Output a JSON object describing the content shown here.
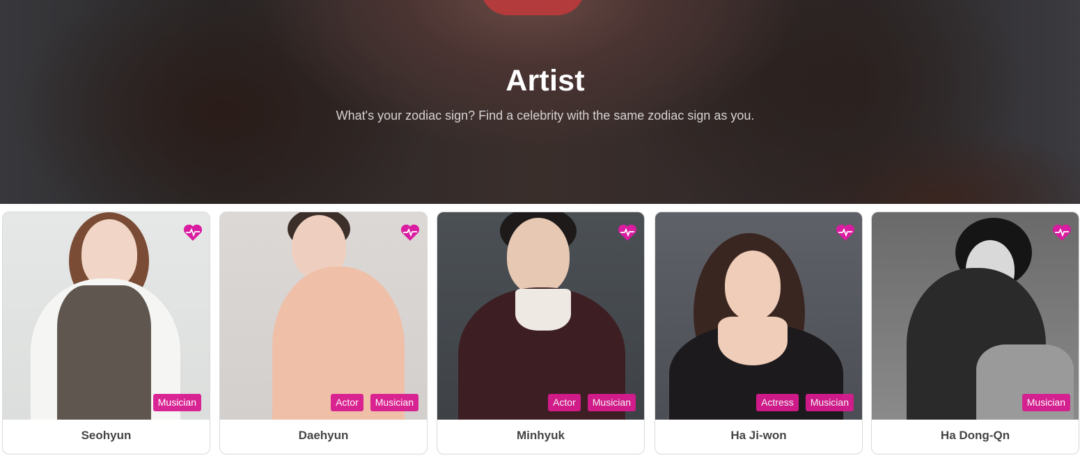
{
  "hero": {
    "title": "Artist",
    "subtitle": "What's your zodiac sign? Find a celebrity with the same zodiac sign as you."
  },
  "colors": {
    "accent": "#d81b8f",
    "heart": "#d91ca0",
    "name_text": "#444444"
  },
  "artists": [
    {
      "name": "Seohyun",
      "tags": [
        "Musician"
      ],
      "favorite_icon": "heartbeat-icon"
    },
    {
      "name": "Daehyun",
      "tags": [
        "Actor",
        "Musician"
      ],
      "favorite_icon": "heartbeat-icon"
    },
    {
      "name": "Minhyuk",
      "tags": [
        "Actor",
        "Musician"
      ],
      "favorite_icon": "heartbeat-icon"
    },
    {
      "name": "Ha Ji-won",
      "tags": [
        "Actress",
        "Musician"
      ],
      "favorite_icon": "heartbeat-icon"
    },
    {
      "name": "Ha Dong-Qn",
      "tags": [
        "Musician"
      ],
      "favorite_icon": "heartbeat-icon"
    }
  ]
}
